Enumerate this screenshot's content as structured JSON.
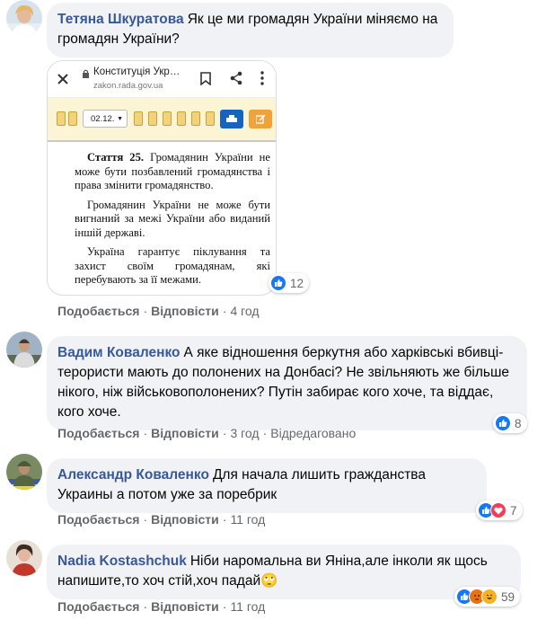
{
  "comments": [
    {
      "author": "Тетяна Шкуратова",
      "text": "Як це ми громадян України міняємо на громадян України?",
      "like_label": "Подобається",
      "reply_label": "Відповісти",
      "time": "4 год",
      "reactions": {
        "count": "12",
        "types": [
          "like"
        ]
      },
      "attachment": {
        "title": "Конституція Укр…",
        "domain": "zakon.rada.gov.ua",
        "select_value": "02.12.",
        "paragraphs": [
          {
            "bold": "Стаття 25.",
            "text": " Громадянин України не може бути позбавлений громадянства і права змінити громадянство."
          },
          {
            "bold": "",
            "text": "Громадянин України не може бути вигнаний за межі України або виданий іншій державі."
          },
          {
            "bold": "",
            "text": "Україна гарантує піклування та захист своїм громадянам, які перебувають за її межами."
          }
        ]
      }
    },
    {
      "author": "Вадим Коваленко",
      "text": "А яке відношення беркутня або харківські вбивці- терористи мають до полонених на Донбасі? Не звільняють же більше нікого, ніж військовополонених? Путін забирає кого хоче, та віддає, кого хоче.",
      "like_label": "Подобається",
      "reply_label": "Відповісти",
      "time": "3 год",
      "edited": "Відредаговано",
      "reactions": {
        "count": "8",
        "types": [
          "like"
        ]
      }
    },
    {
      "author": "Александр Коваленко",
      "text": "Для начала лишить гражданства Украины а потом уже за поребрик",
      "like_label": "Подобається",
      "reply_label": "Відповісти",
      "time": "11 год",
      "reactions": {
        "count": "7",
        "types": [
          "like",
          "love"
        ]
      }
    },
    {
      "author": "Nadia Kostashchuk",
      "text": "Ніби наромальна ви Яніна,але інколи як щось напишите,то хоч стій,хоч падай🙄",
      "like_label": "Подобається",
      "reply_label": "Відповісти",
      "time": "11 год",
      "reactions": {
        "count": "59",
        "types": [
          "like",
          "angry",
          "haha"
        ]
      }
    }
  ],
  "colors": {
    "author": "#385898",
    "bubble": "#f0f2f5",
    "meta": "#65676b",
    "like": "#1877f2"
  }
}
